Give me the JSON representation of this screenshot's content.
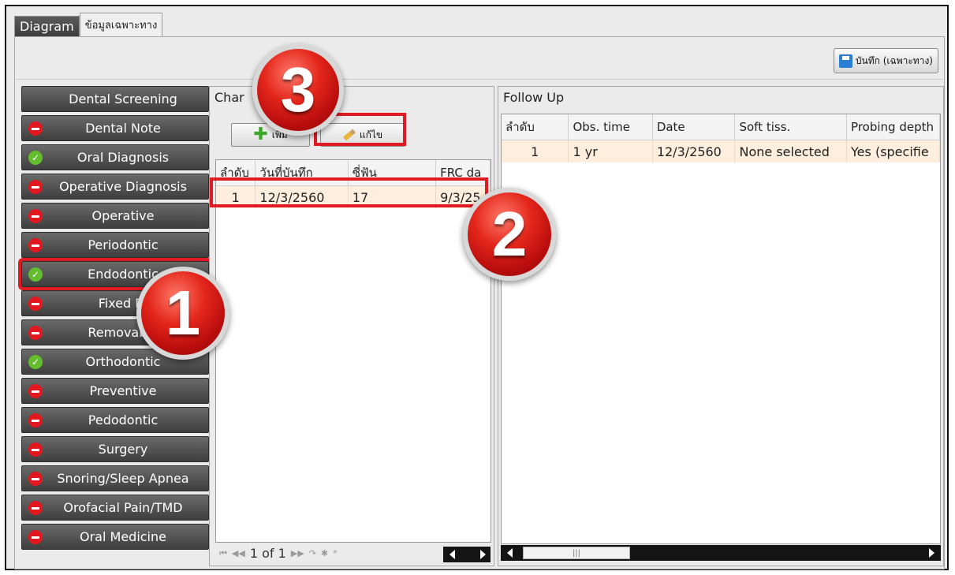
{
  "tabs": [
    {
      "label": "Diagram"
    },
    {
      "label": "ข้อมูลเฉพาะทาง"
    }
  ],
  "toolbar": {
    "save_label": "บันทึก (เฉพาะทาง)"
  },
  "sidebar": {
    "items": [
      {
        "label": "Dental Screening",
        "status": "none"
      },
      {
        "label": "Dental Note",
        "status": "red"
      },
      {
        "label": "Oral Diagnosis",
        "status": "green"
      },
      {
        "label": "Operative Diagnosis",
        "status": "red"
      },
      {
        "label": "Operative",
        "status": "red"
      },
      {
        "label": "Periodontic",
        "status": "red"
      },
      {
        "label": "Endodontic",
        "status": "green"
      },
      {
        "label": "Fixed Pr",
        "status": "red"
      },
      {
        "label": "Removable",
        "status": "red"
      },
      {
        "label": "Orthodontic",
        "status": "green"
      },
      {
        "label": "Preventive",
        "status": "red"
      },
      {
        "label": "Pedodontic",
        "status": "red"
      },
      {
        "label": "Surgery",
        "status": "red"
      },
      {
        "label": "Snoring/Sleep Apnea",
        "status": "red"
      },
      {
        "label": "Orofacial Pain/TMD",
        "status": "red"
      },
      {
        "label": "Oral Medicine",
        "status": "red"
      }
    ]
  },
  "chart_panel": {
    "title": "Char",
    "add_label": "เพิ่ม",
    "edit_label": "แก้ไข",
    "columns": [
      "ลำดับ",
      "วันที่บันทึก",
      "ซี่ฟัน",
      "FRC da"
    ],
    "rows": [
      [
        "1",
        "12/3/2560",
        "17",
        "9/3/25"
      ]
    ],
    "pager": "1 of 1"
  },
  "followup_panel": {
    "title": "Follow Up",
    "columns": [
      "ลำดับ",
      "Obs. time",
      "Date",
      "Soft tiss.",
      "Probing depth"
    ],
    "rows": [
      [
        "1",
        "1 yr",
        "12/3/2560",
        "None selected",
        "Yes (specifie"
      ]
    ]
  },
  "callouts": [
    "1",
    "2",
    "3"
  ],
  "colors": {
    "highlight": "#e01b24",
    "row_bg": "#fdeedd",
    "sidebar_bg": "#4f4f4f"
  }
}
